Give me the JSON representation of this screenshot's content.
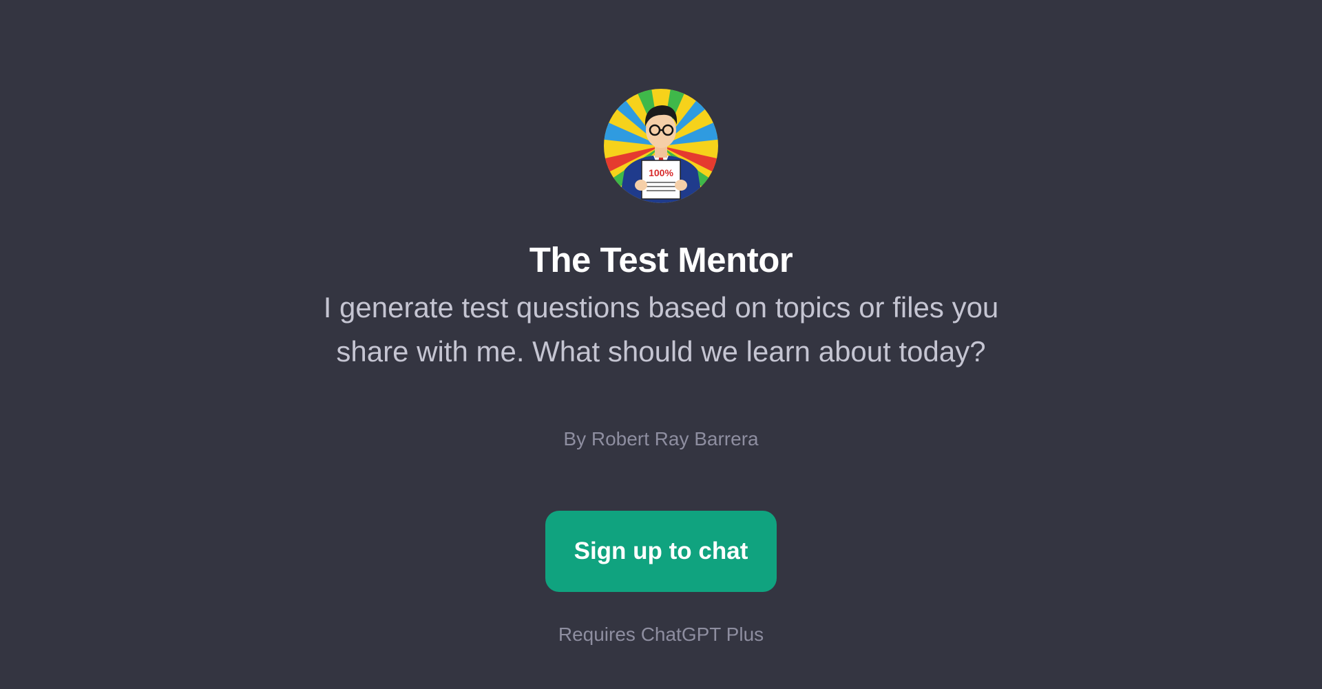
{
  "gpt": {
    "title": "The Test Mentor",
    "description": "I generate test questions based on topics or files you share with me. What should we learn about today?",
    "author": "By Robert Ray Barrera",
    "avatar_icon": "pop-art-test-mentor-avatar",
    "avatar_text": "100%"
  },
  "actions": {
    "signup_label": "Sign up to chat"
  },
  "footer": {
    "requirement": "Requires ChatGPT Plus"
  },
  "colors": {
    "background": "#343541",
    "title": "#ffffff",
    "description": "#c5c5d2",
    "muted": "#8e8ea0",
    "button": "#10a37f"
  }
}
